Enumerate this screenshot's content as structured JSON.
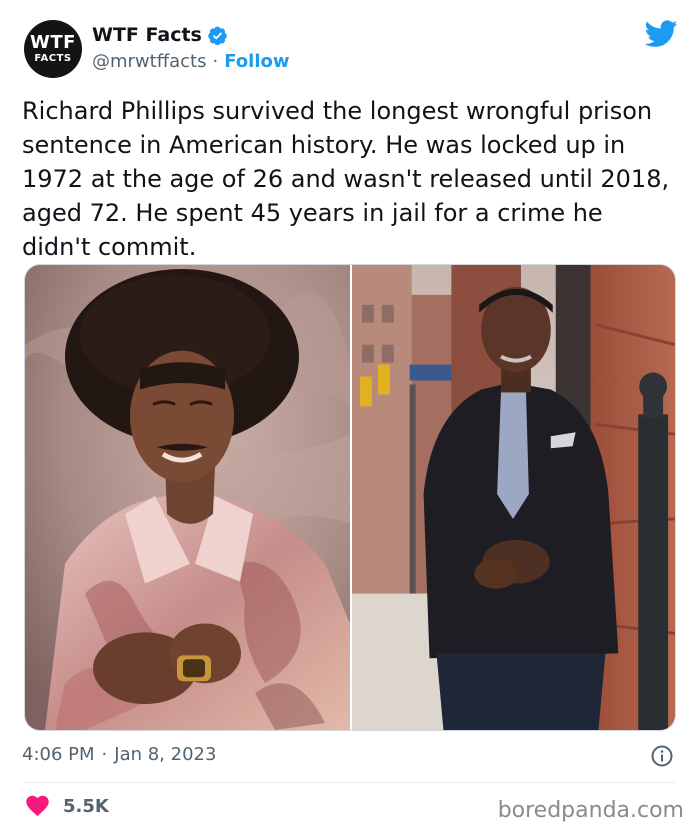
{
  "author": {
    "avatar_line1": "WTF",
    "avatar_line2": "FACTS",
    "name": "WTF Facts",
    "handle": "@mrwtffacts",
    "separator": "·",
    "follow_label": "Follow"
  },
  "tweet": {
    "text": "Richard Phillips survived the longest wrongful prison sentence in American history. He was locked up in 1972 at the age of 26 and wasn't released until 2018, aged 72. He spent 45 years in jail for a crime he didn't commit.",
    "time": "4:06 PM",
    "separator": "·",
    "date": "Jan 8, 2023"
  },
  "engagement": {
    "likes": "5.5K"
  },
  "watermark": "boredpanda.com",
  "icons": {
    "verified": "verified-badge-icon",
    "logo": "twitter-bird-icon",
    "info": "info-icon",
    "like": "heart-icon"
  },
  "colors": {
    "accent": "#1d9bf0",
    "like": "#f91880",
    "text": "#0f1419",
    "secondary": "#536471"
  }
}
